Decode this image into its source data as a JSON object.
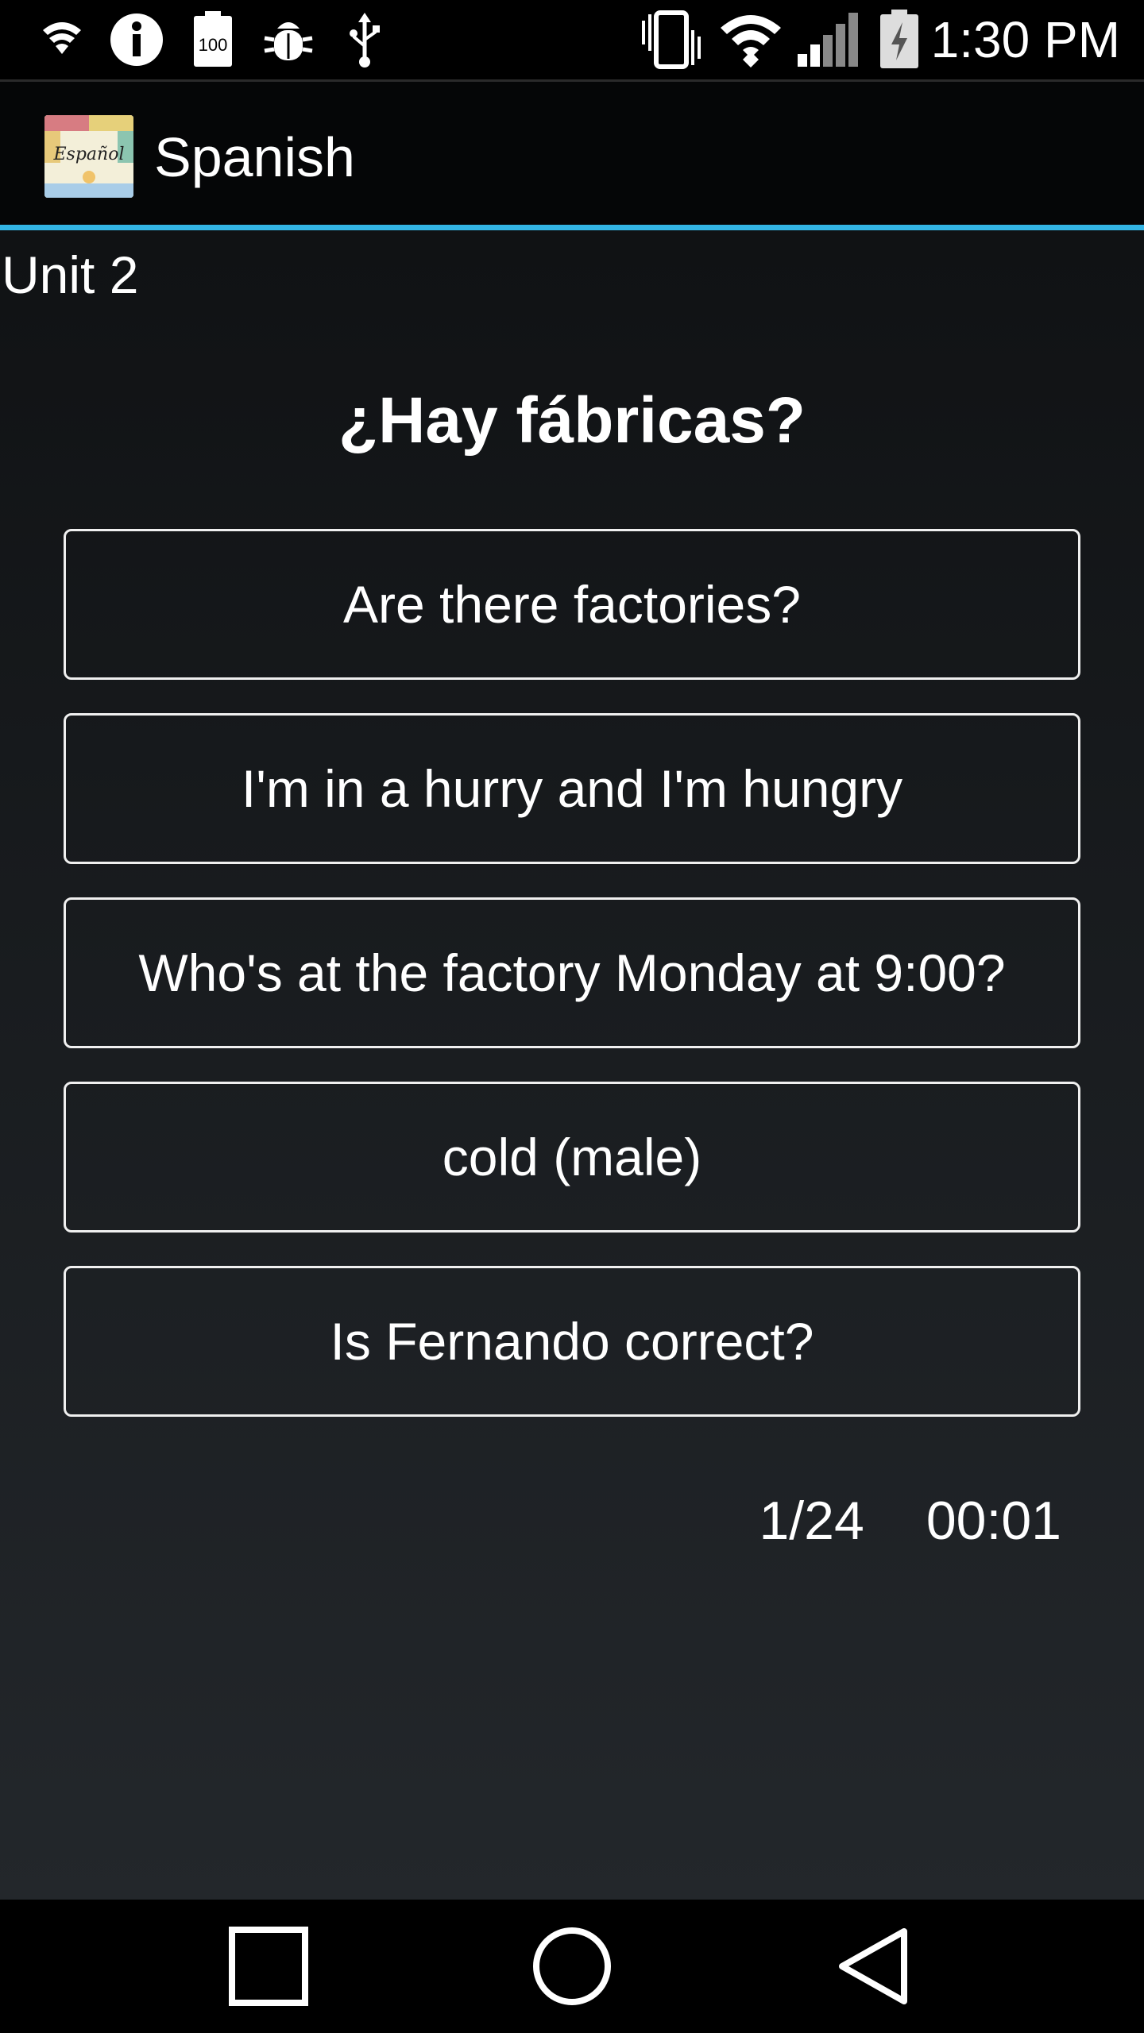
{
  "status_bar": {
    "time": "1:30 PM",
    "battery_left_label": "100",
    "icons": [
      "lookout-shield-icon",
      "info-icon",
      "battery-100-icon",
      "debug-bug-icon",
      "usb-icon",
      "vibrate-icon",
      "wifi-icon",
      "cell-signal-icon",
      "battery-charging-icon"
    ]
  },
  "action_bar": {
    "title": "Spanish",
    "logo_text": "Español"
  },
  "quiz": {
    "unit_label": "Unit 2",
    "question": "¿Hay fábricas?",
    "answers": [
      "Are there factories?",
      "I'm in a hurry and I'm hungry",
      "Who's at the factory Monday at 9:00?",
      "cold (male)",
      "Is Fernando correct?"
    ],
    "progress": "1/24",
    "timer": "00:01"
  },
  "nav_bar": {
    "buttons": [
      "recent-apps-button",
      "home-button",
      "back-button"
    ]
  },
  "colors": {
    "accent": "#33b5e5",
    "background_top": "#101214",
    "background_bottom": "#23272b",
    "button_border": "#f0f0f0"
  }
}
